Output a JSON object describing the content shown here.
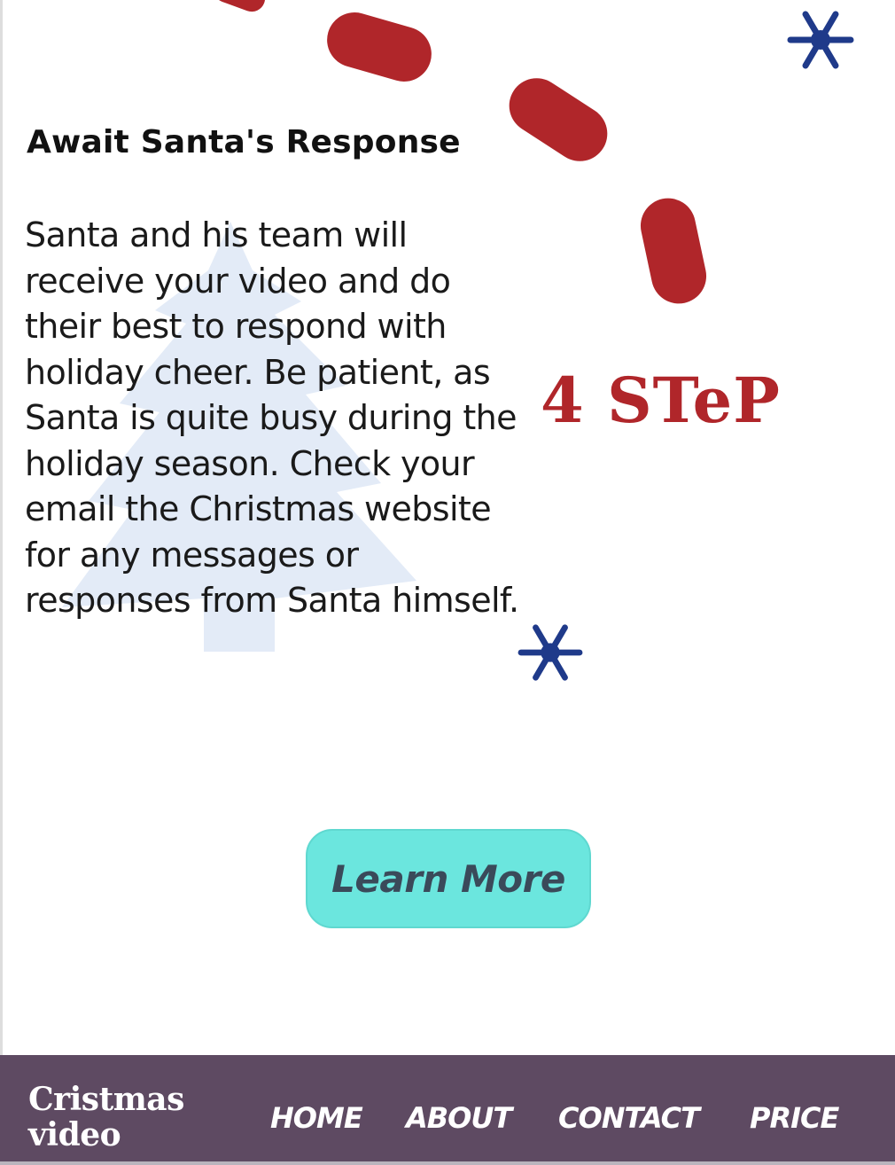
{
  "step": {
    "title": "Await Santa's Response",
    "body": "Santa and his team will receive your video and do their best to respond with holiday cheer. Be patient, as Santa is quite busy during the holiday season. Check your email the Christmas website for any messages or responses from Santa himself.",
    "label": "4 STeP"
  },
  "cta": {
    "label": "Learn More"
  },
  "footer": {
    "brand": "Cristmas video",
    "nav": [
      "HOME",
      "ABOUT",
      "CONTACT",
      "PRICE"
    ]
  },
  "colors": {
    "accent_red": "#b0262a",
    "snowflake_blue": "#1f3a8a",
    "button_teal": "#6be6de",
    "footer_purple": "#5e4a62"
  },
  "icons": [
    "snowflake-icon",
    "christmas-tree-icon"
  ]
}
